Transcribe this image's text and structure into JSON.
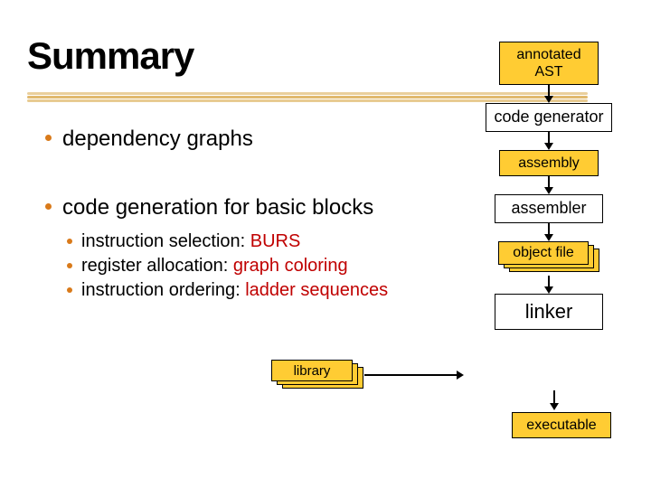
{
  "title": "Summary",
  "bullets": {
    "b1": "dependency graphs",
    "b2": "code generation for basic blocks",
    "sub": [
      {
        "plain": "instruction selection: ",
        "hl": "BURS"
      },
      {
        "plain": "register allocation: ",
        "hl": "graph coloring"
      },
      {
        "plain": "instruction ordering: ",
        "hl": "ladder sequences"
      }
    ]
  },
  "flow": {
    "n1": "annotated AST",
    "n2": "code generator",
    "n3": "assembly",
    "n4": "assembler",
    "n5": "object file",
    "n6": "linker",
    "n7": "executable"
  },
  "library": "library"
}
